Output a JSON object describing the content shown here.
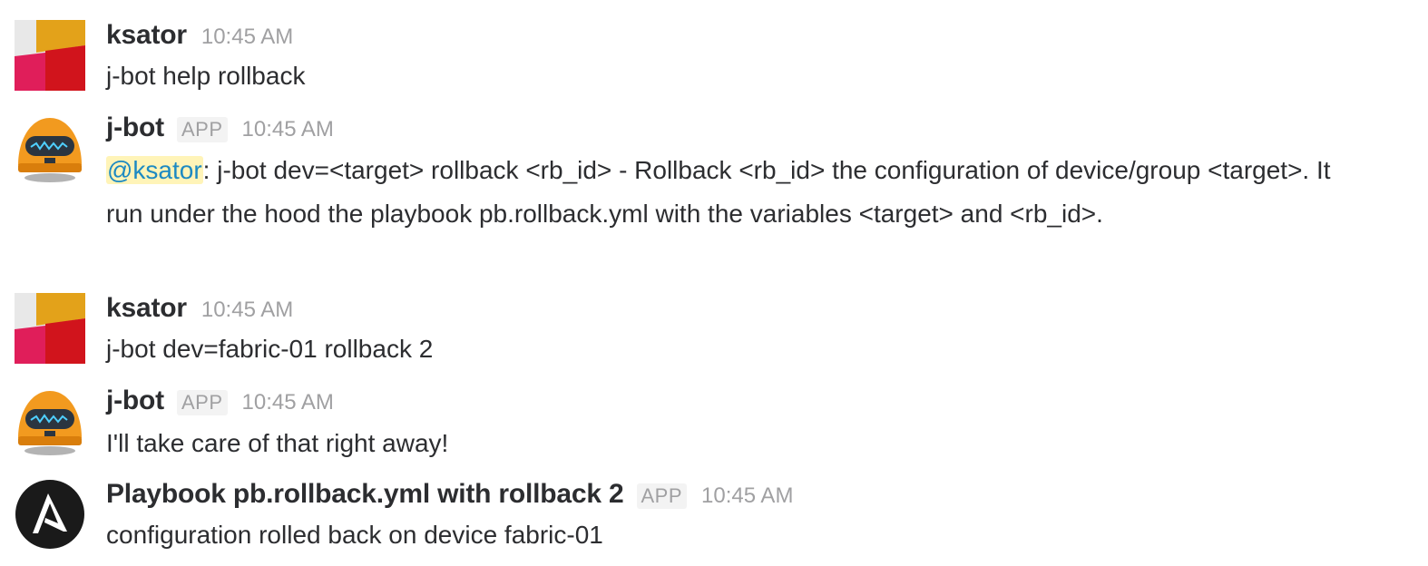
{
  "messages": [
    {
      "author": "ksator",
      "time": "10:45 AM",
      "text": "j-bot help rollback"
    },
    {
      "author": "j-bot",
      "badge": "APP",
      "time": "10:45 AM",
      "mention": "@ksator",
      "text": ": j-bot dev=<target> rollback <rb_id> - Rollback <rb_id> the configuration of device/group <target>. It run under the hood the playbook pb.rollback.yml with the variables <target> and <rb_id>."
    },
    {
      "author": "ksator",
      "time": "10:45 AM",
      "text": "j-bot dev=fabric-01 rollback 2"
    },
    {
      "author": "j-bot",
      "badge": "APP",
      "time": "10:45 AM",
      "text": "I'll take care of that right away!"
    },
    {
      "author": "Playbook pb.rollback.yml with rollback 2",
      "badge": "APP",
      "time": "10:45 AM",
      "text": "configuration rolled back on device fabric-01"
    }
  ],
  "colors": {
    "mention_text": "#1d8ac2",
    "mention_bg": "#fff4b8",
    "timestamp": "#a0a0a2",
    "bot_orange": "#f29a1f",
    "ansible_black": "#1a1a1a"
  },
  "icons": {
    "ksator_avatar": "colorful-block-avatar",
    "jbot_avatar": "robot-avatar",
    "ansible_avatar": "ansible-logo"
  }
}
